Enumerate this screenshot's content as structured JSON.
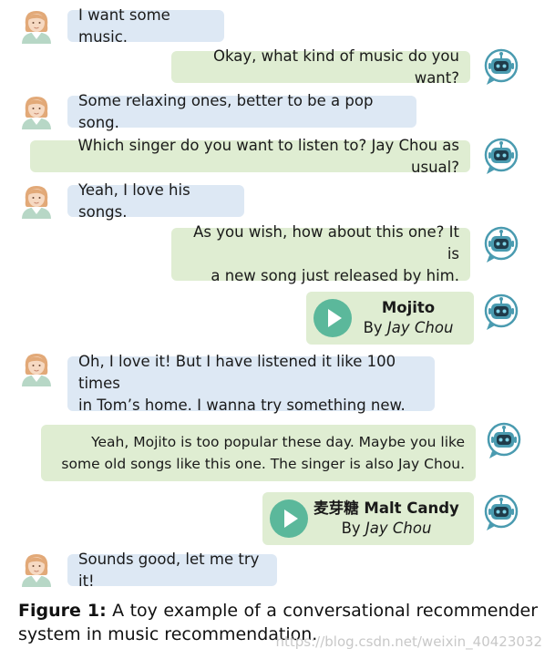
{
  "messages": [
    {
      "role": "user",
      "text": "I want some music."
    },
    {
      "role": "bot",
      "text": "Okay, what kind of music do you want?"
    },
    {
      "role": "user",
      "text": "Some relaxing ones, better to be a pop song."
    },
    {
      "role": "bot",
      "text": "Which singer do you want to listen to? Jay Chou as usual?"
    },
    {
      "role": "user",
      "text": "Yeah, I love his songs."
    },
    {
      "role": "bot",
      "lines": [
        "As you wish, how about this one? It is",
        "a new song just released by him."
      ]
    },
    {
      "role": "bot",
      "song": {
        "title": "Mojito",
        "by_prefix": "By ",
        "artist": "Jay Chou"
      }
    },
    {
      "role": "user",
      "lines": [
        "Oh, I love it! But I have listened it like 100 times",
        "in Tom’s home. I wanna try something new."
      ]
    },
    {
      "role": "bot",
      "lines": [
        "Yeah, Mojito is too popular these day. Maybe you like",
        "some old songs like  this one. The singer is also Jay Chou."
      ]
    },
    {
      "role": "bot",
      "song": {
        "title": "麦芽糖 Malt Candy",
        "by_prefix": "By ",
        "artist": "Jay Chou"
      }
    },
    {
      "role": "user",
      "text": "Sounds good, let me try it!"
    }
  ],
  "caption": {
    "label": "Figure 1:",
    "text": " A toy example of a conversational recommender system in music recommendation."
  },
  "watermark": "https://blog.csdn.net/weixin_40423032",
  "colors": {
    "user_bubble": "#dde8f4",
    "bot_bubble": "#dfedd2",
    "play": "#5bb89b"
  }
}
